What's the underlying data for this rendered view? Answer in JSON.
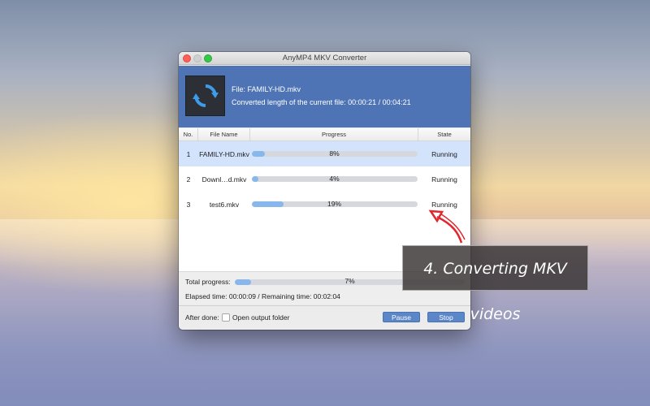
{
  "window": {
    "title": "AnyMP4 MKV Converter"
  },
  "header": {
    "file_line": "File: FAMILY-HD.mkv",
    "length_line": "Converted length of the current file: 00:00:21 / 00:04:21",
    "logo_icon": "convert-refresh-icon"
  },
  "table": {
    "columns": [
      "No.",
      "File Name",
      "Progress",
      "State"
    ],
    "rows": [
      {
        "no": "1",
        "name": "FAMILY-HD.mkv",
        "progress": 8,
        "progress_label": "8%",
        "state": "Running",
        "selected": true
      },
      {
        "no": "2",
        "name": "Downl…d.mkv",
        "progress": 4,
        "progress_label": "4%",
        "state": "Running",
        "selected": false
      },
      {
        "no": "3",
        "name": "test6.mkv",
        "progress": 19,
        "progress_label": "19%",
        "state": "Running",
        "selected": false
      }
    ]
  },
  "status": {
    "total_label": "Total progress:",
    "total_progress": 7,
    "total_progress_label": "7%",
    "elapsed": "Elapsed time: 00:00:09 / Remaining time: 00:02:04"
  },
  "footer": {
    "after_done": "After done:",
    "open_output": "Open output folder",
    "open_output_checked": false,
    "pause": "Pause",
    "stop": "Stop"
  },
  "overlay": {
    "caption": "4. Converting MKV videos"
  },
  "colors": {
    "header": "#4e74b5",
    "progress_fill": "#88b7ec",
    "button": "#5b86c8",
    "arrow": "#e0282e"
  }
}
